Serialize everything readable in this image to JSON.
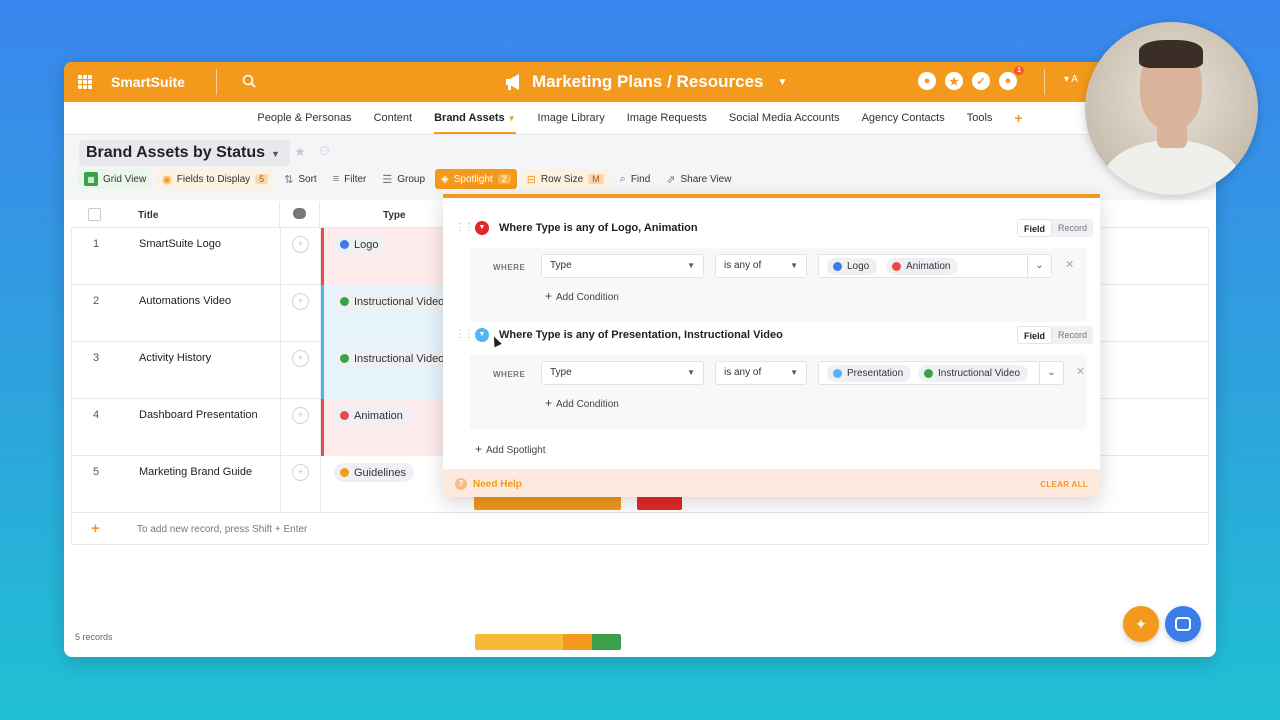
{
  "app": {
    "brand": "SmartSuite",
    "workspace_title": "Marketing Plans / Resources",
    "notif_count": "1",
    "user_initials": "A"
  },
  "colors": {
    "accent": "#f39a1c",
    "blue_tag": "#3a7de8",
    "red_tag": "#e84a4a",
    "green_tag": "#3aa04a",
    "orange_tag": "#f39a1c",
    "light_blue_tag": "#4cb6f0"
  },
  "tabs": [
    {
      "label": "People & Personas"
    },
    {
      "label": "Content"
    },
    {
      "label": "Brand Assets"
    },
    {
      "label": "Image Library"
    },
    {
      "label": "Image Requests"
    },
    {
      "label": "Social Media Accounts"
    },
    {
      "label": "Agency Contacts"
    },
    {
      "label": "Tools"
    },
    {
      "label": "+"
    }
  ],
  "view": {
    "title": "Brand Assets by Status"
  },
  "toolbar": {
    "grid_view": "Grid View",
    "fields": "Fields to Display",
    "fields_count": "5",
    "sort": "Sort",
    "filter": "Filter",
    "group": "Group",
    "spotlight": "Spotlight",
    "spotlight_count": "2",
    "row_size": "Row Size",
    "row_size_value": "M",
    "find": "Find",
    "share": "Share View"
  },
  "grid": {
    "headers": {
      "title": "Title",
      "type": "Type"
    },
    "rows": [
      {
        "num": "1",
        "title": "SmartSuite Logo",
        "type": "Logo"
      },
      {
        "num": "2",
        "title": "Automations Video",
        "type": "Instructional Video"
      },
      {
        "num": "3",
        "title": "Activity History",
        "type": "Instructional Video"
      },
      {
        "num": "4",
        "title": "Dashboard Presentation",
        "type": "Animation"
      },
      {
        "num": "5",
        "title": "Marketing Brand Guide",
        "type": "Guidelines"
      }
    ],
    "add_hint": "To add new record, press Shift + Enter",
    "record_count": "5 records"
  },
  "spotlight": {
    "items": [
      {
        "title": "Where Type is any of Logo, Animation",
        "mode_field": "Field",
        "mode_record": "Record",
        "where": "WHERE",
        "field": "Type",
        "operator": "is any of",
        "values": [
          "Logo",
          "Animation"
        ],
        "add_condition": "Add Condition"
      },
      {
        "title": "Where Type is any of Presentation, Instructional Video",
        "mode_field": "Field",
        "mode_record": "Record",
        "where": "WHERE",
        "field": "Type",
        "operator": "is any of",
        "values": [
          "Presentation",
          "Instructional Video"
        ],
        "add_condition": "Add Condition"
      }
    ],
    "add_spotlight": "Add Spotlight",
    "need_help": "Need Help",
    "clear_all": "CLEAR ALL"
  }
}
